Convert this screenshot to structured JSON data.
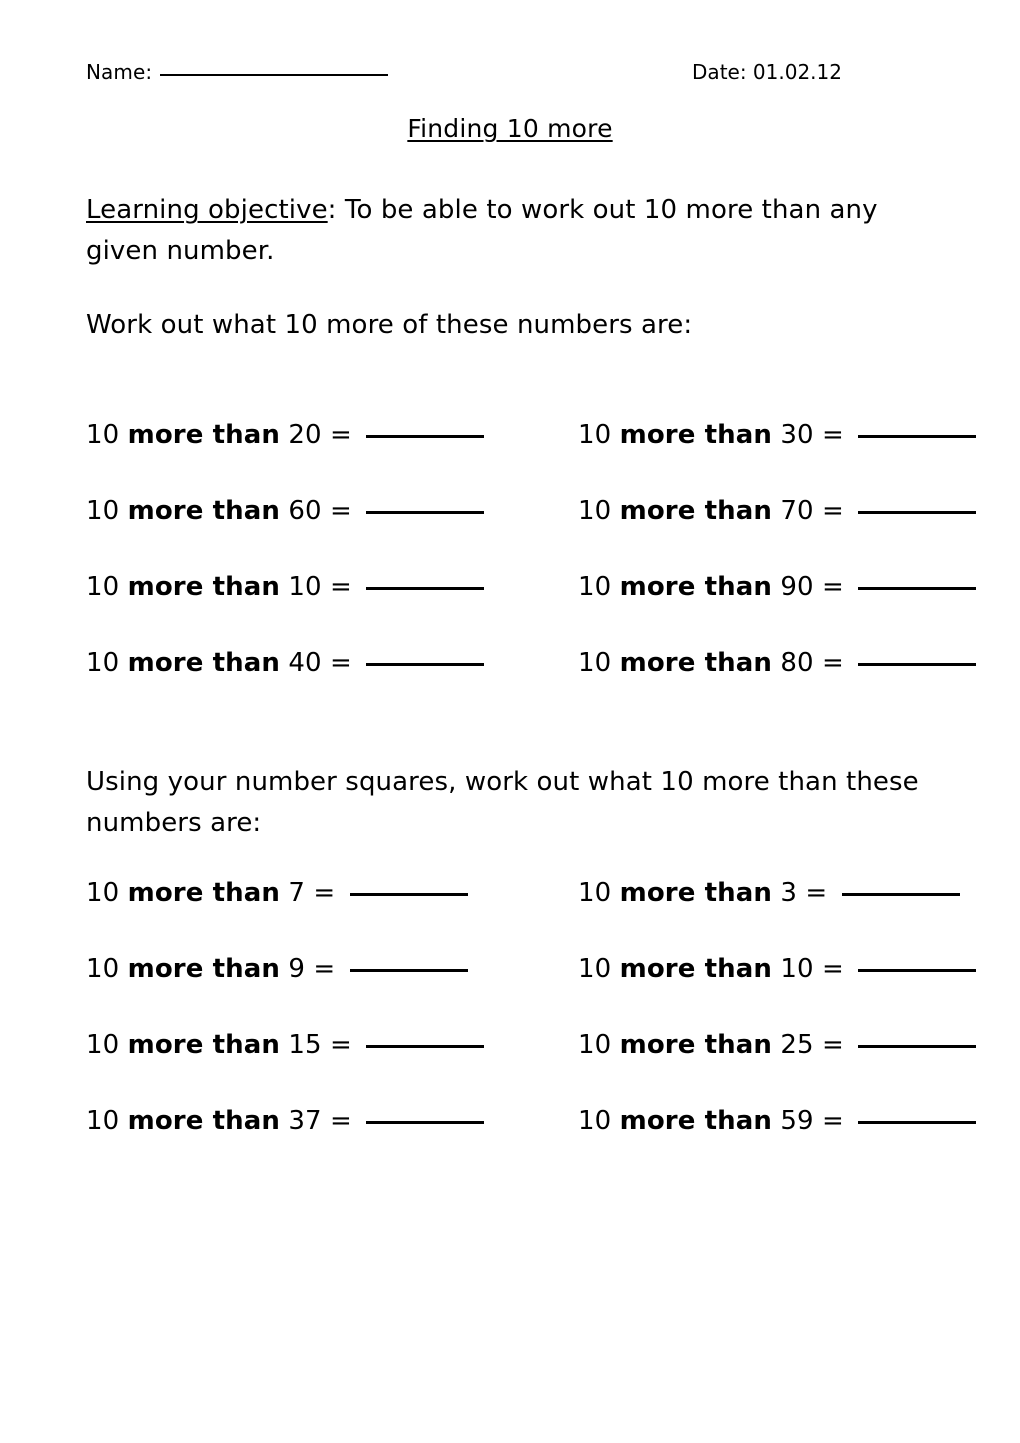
{
  "header": {
    "name_label": "Name:",
    "date_text": "Date: 01.02.12"
  },
  "title": "Finding 10 more",
  "objective": {
    "label": "Learning objective",
    "body": ": To be able to work out 10 more than any given number."
  },
  "instructions": {
    "first": "Work out what 10 more of these numbers are:",
    "second": "Using your number squares, work out what 10 more than these numbers are:"
  },
  "question_parts": {
    "lead": "10 ",
    "phrase": "more than",
    "equals": " = "
  },
  "sections": [
    {
      "id": "section-one",
      "rows": [
        {
          "left": "20",
          "right": "30"
        },
        {
          "left": "60",
          "right": "70"
        },
        {
          "left": "10",
          "right": "90"
        },
        {
          "left": "40",
          "right": "80"
        }
      ]
    },
    {
      "id": "section-two",
      "rows": [
        {
          "left": "7",
          "right": "3"
        },
        {
          "left": "9",
          "right": "10"
        },
        {
          "left": "15",
          "right": "25"
        },
        {
          "left": "37",
          "right": "59"
        }
      ]
    }
  ]
}
